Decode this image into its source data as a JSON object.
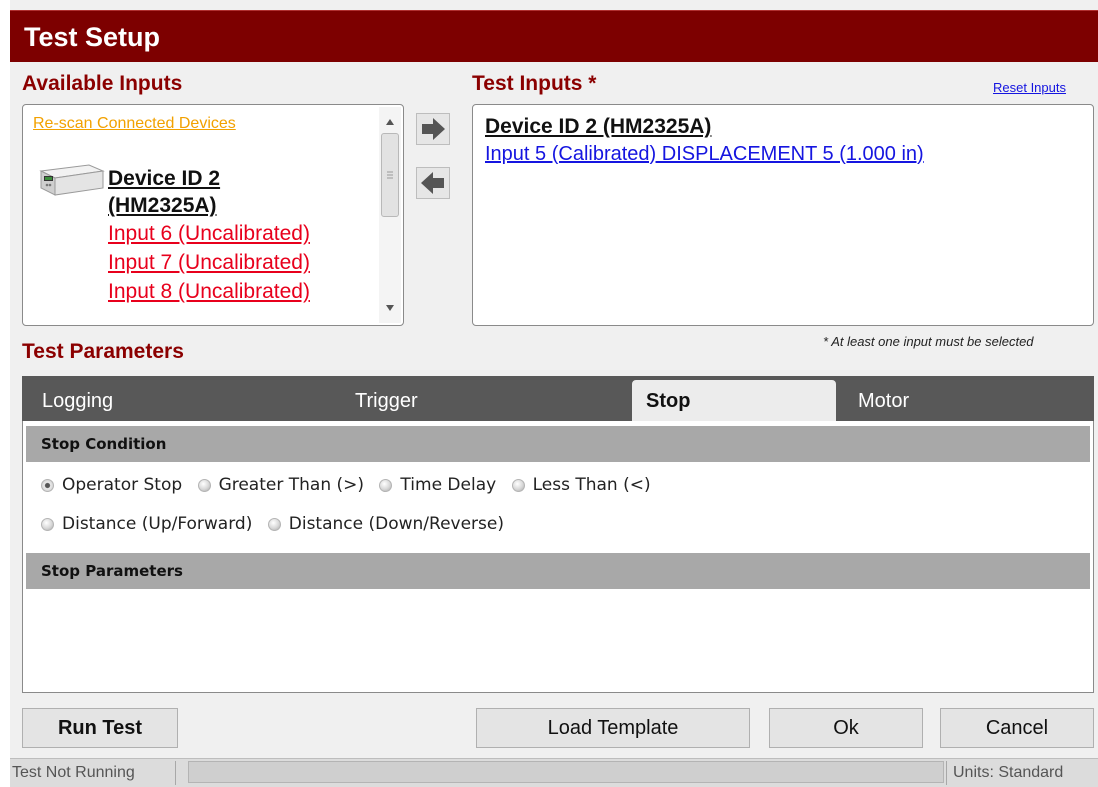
{
  "window": {
    "title": "Test Setup"
  },
  "available_inputs": {
    "heading": "Available Inputs",
    "rescan_link": "Re-scan Connected Devices",
    "device": {
      "icon": "device-hm2325a-icon",
      "name_line1": "Device ID 2",
      "name_line2": "(HM2325A)"
    },
    "inputs": [
      "Input 6 (Uncalibrated)",
      "Input 7 (Uncalibrated)",
      "Input 8 (Uncalibrated)"
    ]
  },
  "transfer": {
    "add_icon": "arrow-right-icon",
    "remove_icon": "arrow-left-icon"
  },
  "test_inputs": {
    "heading": "Test Inputs",
    "required_marker": "*",
    "reset_link": "Reset Inputs",
    "device_name": "Device ID 2 (HM2325A)",
    "inputs": [
      "Input 5 (Calibrated) DISPLACEMENT 5 (1.000 in)"
    ],
    "note": "* At least one input must be selected"
  },
  "test_parameters": {
    "heading": "Test Parameters",
    "tabs": [
      "Logging",
      "Trigger",
      "Stop",
      "Motor"
    ],
    "active_tab": "Stop",
    "stop_condition": {
      "header": "Stop Condition",
      "options": [
        "Operator Stop",
        "Greater Than (>)",
        "Time Delay",
        "Less Than (<)",
        "Distance (Up/Forward)",
        "Distance (Down/Reverse)"
      ],
      "selected": "Operator Stop"
    },
    "stop_parameters": {
      "header": "Stop Parameters"
    }
  },
  "buttons": {
    "run_test": "Run Test",
    "load_template": "Load Template",
    "ok": "Ok",
    "cancel": "Cancel"
  },
  "status_bar": {
    "test_status": "Test Not Running",
    "units": "Units: Standard"
  },
  "colors": {
    "title_bar": "#7d0000",
    "section_heading": "#8b0000",
    "link_orange": "#f2a100",
    "link_red": "#e8001c",
    "link_blue": "#1515e0",
    "tab_bar": "#585858",
    "group_header": "#a8a8a8"
  }
}
